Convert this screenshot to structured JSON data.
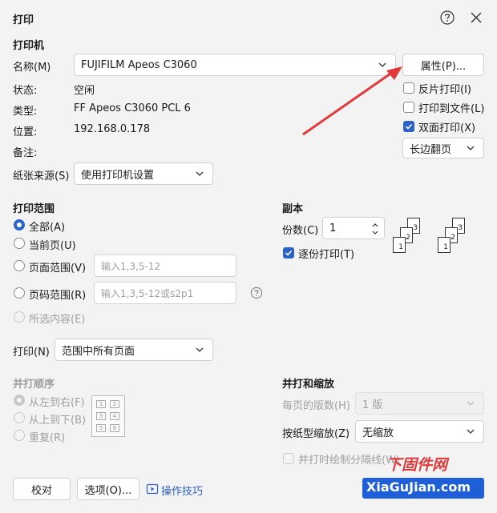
{
  "window": {
    "title": "打印"
  },
  "printer": {
    "section_title": "打印机",
    "name_label": "名称(M)",
    "name_value": "FUJIFILM Apeos C3060",
    "properties_button": "属性(P)...",
    "status_label": "状态:",
    "status_value": "空闲",
    "type_label": "类型:",
    "type_value": "FF Apeos C3060 PCL 6",
    "location_label": "位置:",
    "location_value": "192.168.0.178",
    "comment_label": "备注:",
    "paper_source_label": "纸张来源(S)",
    "paper_source_value": "使用打印机设置",
    "reverse_print": "反片打印(I)",
    "print_to_file": "打印到文件(L)",
    "duplex": "双面打印(X)",
    "flip_value": "长边翻页"
  },
  "range": {
    "section_title": "打印范围",
    "all": "全部(A)",
    "current_page": "当前页(U)",
    "page_range": "页面范围(V)",
    "page_range_placeholder": "输入1,3,5-12",
    "page_number_range": "页码范围(R)",
    "page_number_placeholder": "输入1,3,5-12或s2p1",
    "selection": "所选内容(E)",
    "print_label": "打印(N)",
    "print_value": "范围中所有页面"
  },
  "copies": {
    "section_title": "副本",
    "count_label": "份数(C)",
    "count_value": "1",
    "collate": "逐份打印(T)",
    "page_labels": [
      "1",
      "2",
      "3"
    ]
  },
  "order": {
    "section_title": "并打顺序",
    "left_to_right": "从左到右(F)",
    "top_to_bottom": "从上到下(B)",
    "repeat": "重复(R)",
    "cells": [
      "1",
      "2",
      "3",
      "4",
      "5",
      "6"
    ]
  },
  "scale": {
    "section_title": "并打和缩放",
    "pages_per_sheet_label": "每页的版数(H)",
    "pages_per_sheet_value": "1 版",
    "scale_to_paper_label": "按纸型缩放(Z)",
    "scale_to_paper_value": "无缩放",
    "draw_borders": "并打时绘制分隔线(W)"
  },
  "footer": {
    "proof_button": "校对",
    "options_button": "选项(O)...",
    "tips_link": "操作技巧"
  },
  "watermark": {
    "line1": "下固件网",
    "line2": "XiaGuJian.com"
  },
  "colors": {
    "accent": "#2a62c9",
    "arrow": "#e23a3a",
    "background": "#f3f3f3"
  }
}
